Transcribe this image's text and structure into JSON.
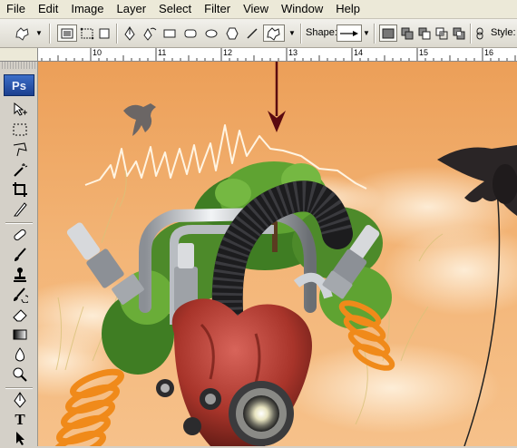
{
  "menu": [
    "File",
    "Edit",
    "Image",
    "Layer",
    "Select",
    "Filter",
    "View",
    "Window",
    "Help"
  ],
  "options_bar": {
    "shape_label": "Shape:",
    "style_label": "Style:"
  },
  "ruler": {
    "labels": [
      "10",
      "11",
      "12",
      "13",
      "14",
      "15",
      "16"
    ]
  },
  "toolbox": {
    "logo": "Ps",
    "type_tool_glyph": "T"
  },
  "colors": {
    "sky_top": "#f0b06a",
    "sky_bottom": "#f7c48a",
    "arrow": "#5a0a10",
    "foliage": "#4d8a2a",
    "heart": "#a8342a",
    "coil": "#f08a1a"
  }
}
